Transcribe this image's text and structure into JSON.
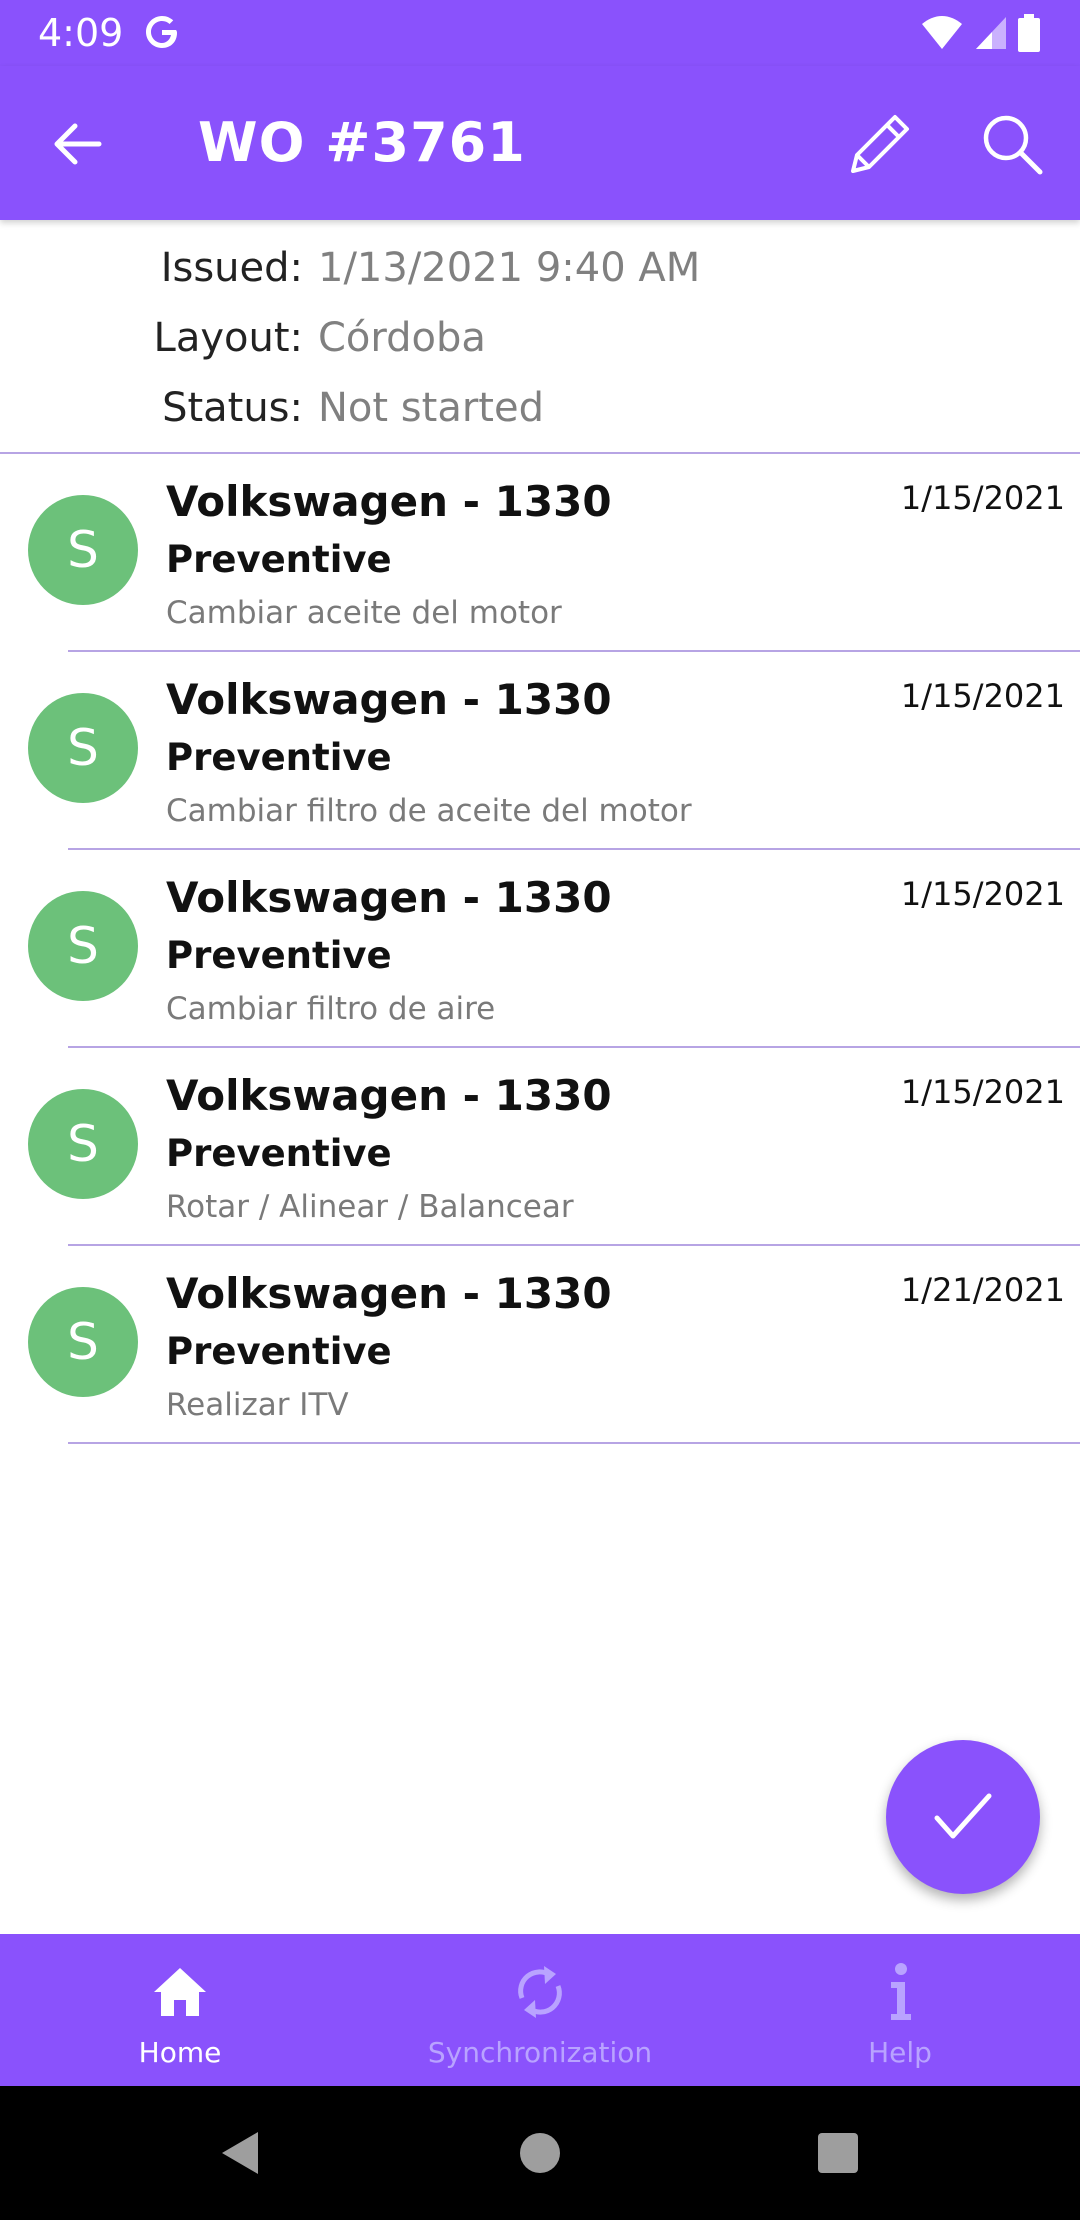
{
  "status_bar": {
    "time": "4:09"
  },
  "app_bar": {
    "title": "WO #3761"
  },
  "details": [
    {
      "label": "Issued:",
      "value": "1/13/2021 9:40 AM"
    },
    {
      "label": "Layout:",
      "value": "Córdoba"
    },
    {
      "label": "Status:",
      "value": "Not started"
    }
  ],
  "work_orders": [
    {
      "avatar": "S",
      "equipment": "Volkswagen - 1330",
      "type": "Preventive",
      "task": "Cambiar aceite del motor",
      "date": "1/15/2021"
    },
    {
      "avatar": "S",
      "equipment": "Volkswagen - 1330",
      "type": "Preventive",
      "task": "Cambiar filtro de aceite del motor",
      "date": "1/15/2021"
    },
    {
      "avatar": "S",
      "equipment": "Volkswagen - 1330",
      "type": "Preventive",
      "task": "Cambiar filtro de aire",
      "date": "1/15/2021"
    },
    {
      "avatar": "S",
      "equipment": "Volkswagen - 1330",
      "type": "Preventive",
      "task": "Rotar / Alinear / Balancear",
      "date": "1/15/2021"
    },
    {
      "avatar": "S",
      "equipment": "Volkswagen - 1330",
      "type": "Preventive",
      "task": "Realizar ITV",
      "date": "1/21/2021"
    }
  ],
  "bottom_nav": [
    {
      "label": "Home",
      "icon": "home-icon",
      "active": true
    },
    {
      "label": "Synchronization",
      "icon": "sync-icon",
      "active": false
    },
    {
      "label": "Help",
      "icon": "info-icon",
      "active": false
    }
  ],
  "colors": {
    "primary": "#8a52fc",
    "avatar": "#6cc17a",
    "divider": "#b7a4e4",
    "inactive_nav": "#b9a3ff"
  }
}
